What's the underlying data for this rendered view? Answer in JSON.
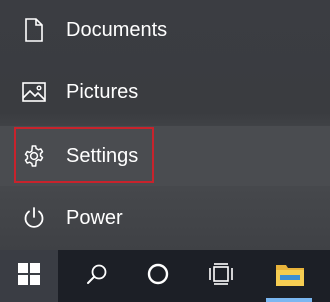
{
  "start_menu": {
    "items": [
      {
        "label": "Documents",
        "icon": "document-icon"
      },
      {
        "label": "Pictures",
        "icon": "pictures-icon"
      },
      {
        "label": "Settings",
        "icon": "gear-icon"
      },
      {
        "label": "Power",
        "icon": "power-icon"
      }
    ]
  },
  "taskbar": {
    "buttons": [
      "windows-logo-icon",
      "search-icon",
      "cortana-icon",
      "task-view-icon",
      "file-explorer-icon"
    ]
  },
  "colors": {
    "highlight_border": "#c8232c",
    "active_indicator": "#7ab6f0",
    "text": "#ffffff"
  }
}
